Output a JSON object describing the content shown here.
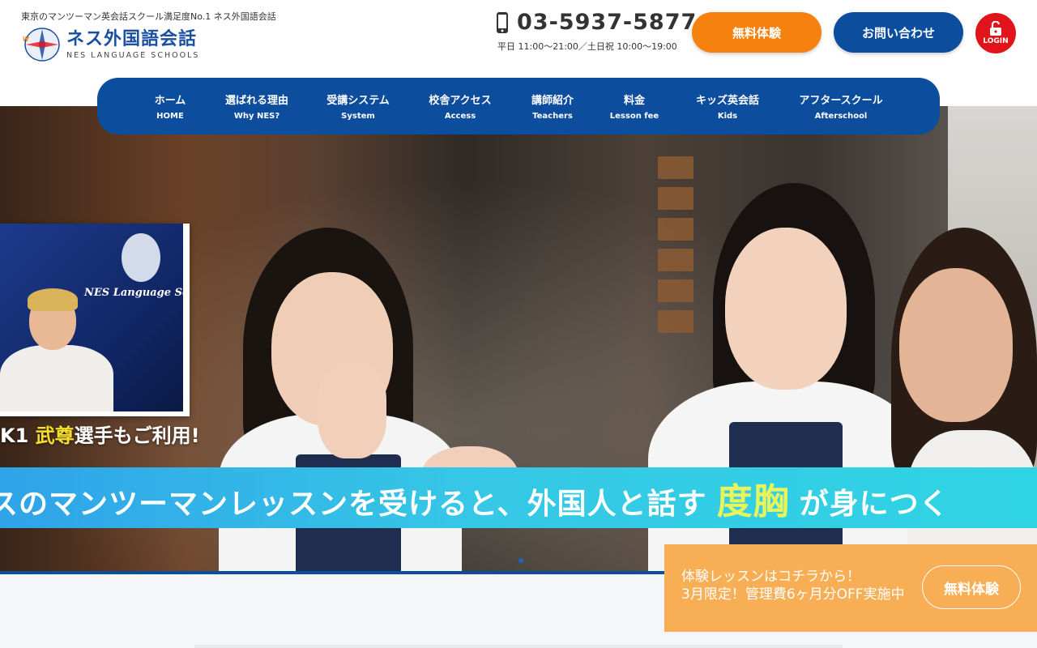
{
  "header": {
    "tagline": "東京のマンツーマン英会話スクール満足度No.1 ネス外国語会話",
    "logo_jp": "ネス外国語会話",
    "logo_en": "NES LANGUAGE SCHOOLS",
    "phone_number": "03-5937-5877",
    "hours": "平日 11:00〜21:00／土日祝 10:00〜19:00",
    "trial_button": "無料体験",
    "contact_button": "お問い合わせ",
    "login_label": "LOGIN"
  },
  "nav": {
    "items": [
      {
        "jp": "ホーム",
        "en": "HOME"
      },
      {
        "jp": "選ばれる理由",
        "en": "Why NES?"
      },
      {
        "jp": "受講システム",
        "en": "System"
      },
      {
        "jp": "校舎アクセス",
        "en": "Access"
      },
      {
        "jp": "講師紹介",
        "en": "Teachers"
      },
      {
        "jp": "料金",
        "en": "Lesson fee"
      },
      {
        "jp": "キッズ英会話",
        "en": "Kids"
      },
      {
        "jp": "アフタースクール",
        "en": "Afterschool"
      }
    ]
  },
  "hero": {
    "photo_sign": "NES Language Schools",
    "caption_prefix": "K1 ",
    "caption_highlight": "武尊",
    "caption_suffix": "選手もご利用!",
    "banner_prefix": "スのマンツーマンレッスン",
    "banner_mid": "を受けると、外国人と話す",
    "banner_highlight": "度胸",
    "banner_suffix": "が身につく"
  },
  "cta": {
    "line1": "体験レッスンはコチラから！",
    "line2": "3月限定！管理費6ヶ月分OFF実施中",
    "button": "無料体験"
  },
  "colors": {
    "brand_blue": "#0d4d9e",
    "trial_orange": "#f5820f",
    "login_red": "#e0151b",
    "cta_orange": "#f8ae55",
    "banner_cyan": "#36c7e6",
    "highlight_yellow": "#e8f55a"
  }
}
